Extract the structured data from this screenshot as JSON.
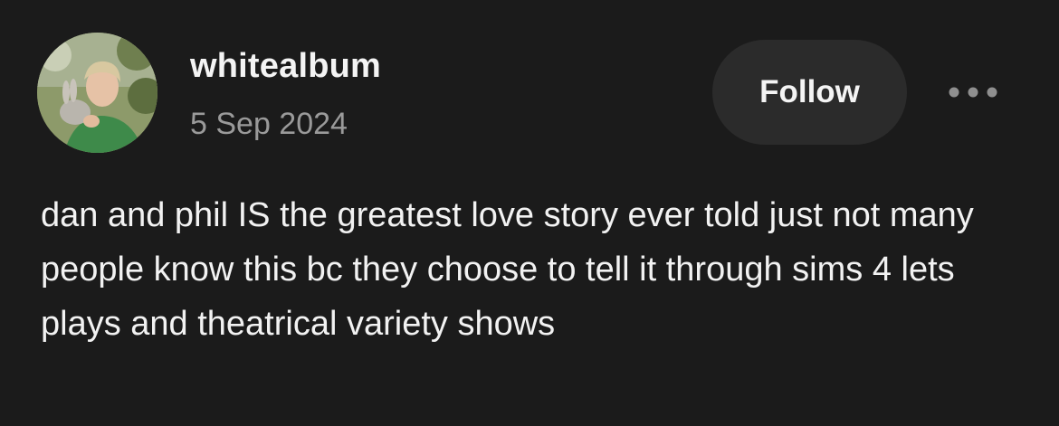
{
  "post": {
    "author": {
      "username": "whitealbum",
      "avatar_icon": "avatar-photo"
    },
    "date": "5 Sep 2024",
    "follow_label": "Follow",
    "more_icon": "more-horizontal-icon",
    "body": "dan and phil IS the greatest love story ever told just not many people know this bc they choose to tell it through sims 4 lets plays and theatrical variety shows"
  },
  "colors": {
    "background": "#1b1b1b",
    "text": "#f2f2f2",
    "muted_text": "#9a9a9a",
    "button_bg": "#2b2b2b"
  }
}
